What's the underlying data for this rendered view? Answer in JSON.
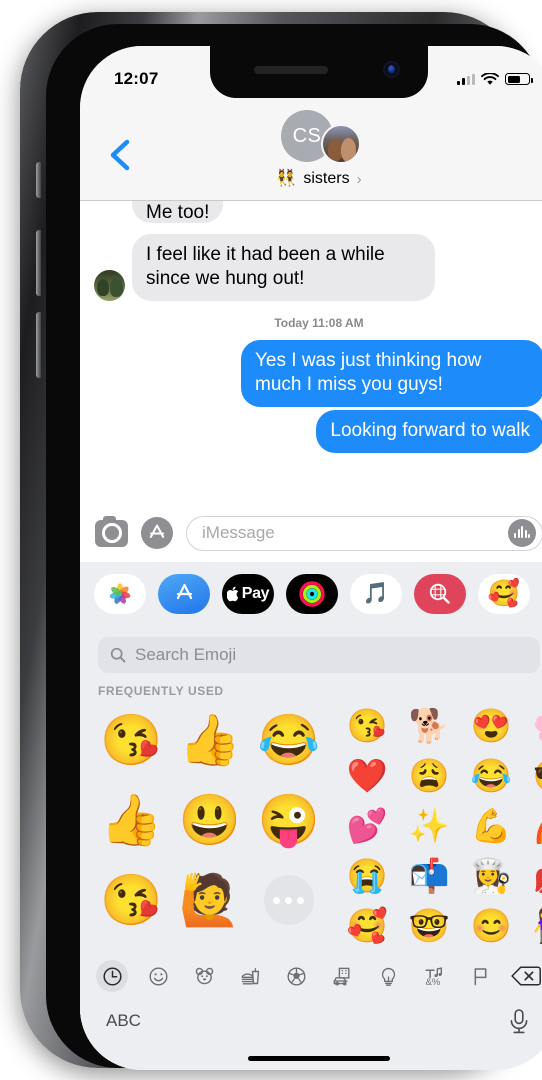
{
  "status_bar": {
    "time": "12:07",
    "signal_bars_filled": 2,
    "signal_bars_total": 4,
    "wifi_icon": "wifi-icon",
    "battery_icon": "battery-icon",
    "battery_percent": 62
  },
  "header": {
    "back_icon": "chevron-left-icon",
    "avatar_initials": "CS",
    "avatar_photo_name": "group-photo-avatar",
    "group_emoji": "👯",
    "group_name": "sisters",
    "disclosure_icon": "chevron-right-icon",
    "disclosure_glyph": "›"
  },
  "conversation": {
    "clipped_message": "Me too!",
    "messages": [
      {
        "side": "in",
        "text": "I feel like it had been a while since we hung out!",
        "has_avatar": true
      },
      {
        "side": "out",
        "text": "Yes I was just thinking how much I miss you guys!",
        "has_avatar": false
      },
      {
        "side": "out",
        "text": "Looking forward to walk",
        "has_avatar": false
      }
    ],
    "timestamp": "Today 11:08 AM"
  },
  "input_bar": {
    "camera_icon": "camera-icon",
    "appstore_icon": "app-store-icon",
    "placeholder": "iMessage",
    "audio_icon": "audio-waveform-icon"
  },
  "app_drawer": {
    "apps": [
      {
        "name": "photos-app",
        "icon": "photos-icon",
        "style": "white"
      },
      {
        "name": "app-store-app",
        "icon": "app-store-icon",
        "style": "blue"
      },
      {
        "name": "apple-pay-app",
        "icon": "apple-pay-icon",
        "style": "black",
        "label": "Pay"
      },
      {
        "name": "fitness-app",
        "icon": "activity-rings-icon",
        "style": "black"
      },
      {
        "name": "music-app",
        "icon": "music-note-icon",
        "style": "white",
        "glyph": "🎵"
      },
      {
        "name": "images-app",
        "icon": "image-search-icon",
        "style": "red"
      },
      {
        "name": "memoji-app",
        "icon": "memoji-sticker-icon",
        "style": "white",
        "glyph": "🥰"
      }
    ]
  },
  "emoji_keyboard": {
    "search_icon": "search-icon",
    "search_placeholder": "Search Emoji",
    "section_label": "FREQUENTLY USED",
    "memoji": [
      {
        "glyph": "😘",
        "name": "memoji-kiss-heart-cap"
      },
      {
        "glyph": "👍",
        "name": "memoji-thumbs-up-hat"
      },
      {
        "glyph": "😂",
        "name": "memoji-laughing-tears-hat"
      },
      {
        "glyph": "👍",
        "name": "memoji-thumbs-up-cap"
      },
      {
        "glyph": "😃",
        "name": "memoji-smiling-cap"
      },
      {
        "glyph": "😜",
        "name": "memoji-tongue-wink-cap"
      },
      {
        "glyph": "😘",
        "name": "memoji-kiss-heart-bangs"
      },
      {
        "glyph": "🙋",
        "name": "memoji-waving-hand-cap"
      }
    ],
    "more_memoji_name": "more-memoji-button",
    "emoji": [
      {
        "glyph": "😘",
        "name": "face-blowing-a-kiss"
      },
      {
        "glyph": "🐕",
        "name": "dog"
      },
      {
        "glyph": "😍",
        "name": "smiling-face-with-heart-eyes"
      },
      {
        "glyph": "🌸",
        "name": "cherry-blossom"
      },
      {
        "glyph": "❤️",
        "name": "red-heart"
      },
      {
        "glyph": "😩",
        "name": "weary-face"
      },
      {
        "glyph": "😂",
        "name": "face-with-tears-of-joy"
      },
      {
        "glyph": "😎",
        "name": "smiling-face-with-sunglasses"
      },
      {
        "glyph": "💕",
        "name": "two-hearts"
      },
      {
        "glyph": "✨",
        "name": "sparkles"
      },
      {
        "glyph": "💪",
        "name": "flexed-biceps"
      },
      {
        "glyph": "🌈",
        "name": "rainbow"
      },
      {
        "glyph": "😭",
        "name": "loudly-crying-face"
      },
      {
        "glyph": "📬",
        "name": "open-mailbox-with-raised-flag"
      },
      {
        "glyph": "👩‍🍳",
        "name": "woman-cook"
      },
      {
        "glyph": "💋",
        "name": "kiss-mark"
      },
      {
        "glyph": "🥰",
        "name": "smiling-face-with-hearts"
      },
      {
        "glyph": "🤓",
        "name": "nerd-face"
      },
      {
        "glyph": "😊",
        "name": "smiling-face-with-smiling-eyes"
      },
      {
        "glyph": "👭",
        "name": "women-holding-hands"
      }
    ],
    "categories": [
      {
        "name": "category-recent",
        "icon": "clock-icon",
        "active": true
      },
      {
        "name": "category-smileys",
        "icon": "smiley-icon",
        "active": false
      },
      {
        "name": "category-animals",
        "icon": "bear-icon",
        "active": false
      },
      {
        "name": "category-food",
        "icon": "burger-drink-icon",
        "active": false
      },
      {
        "name": "category-activity",
        "icon": "soccer-ball-icon",
        "active": false
      },
      {
        "name": "category-travel",
        "icon": "car-building-icon",
        "active": false
      },
      {
        "name": "category-objects",
        "icon": "lightbulb-icon",
        "active": false
      },
      {
        "name": "category-symbols",
        "icon": "symbols-icon",
        "active": false
      },
      {
        "name": "category-flags",
        "icon": "flag-icon",
        "active": false
      }
    ],
    "delete_icon": "delete-backward-icon"
  },
  "bottom_bar": {
    "abc_label": "ABC",
    "mic_icon": "microphone-icon"
  }
}
